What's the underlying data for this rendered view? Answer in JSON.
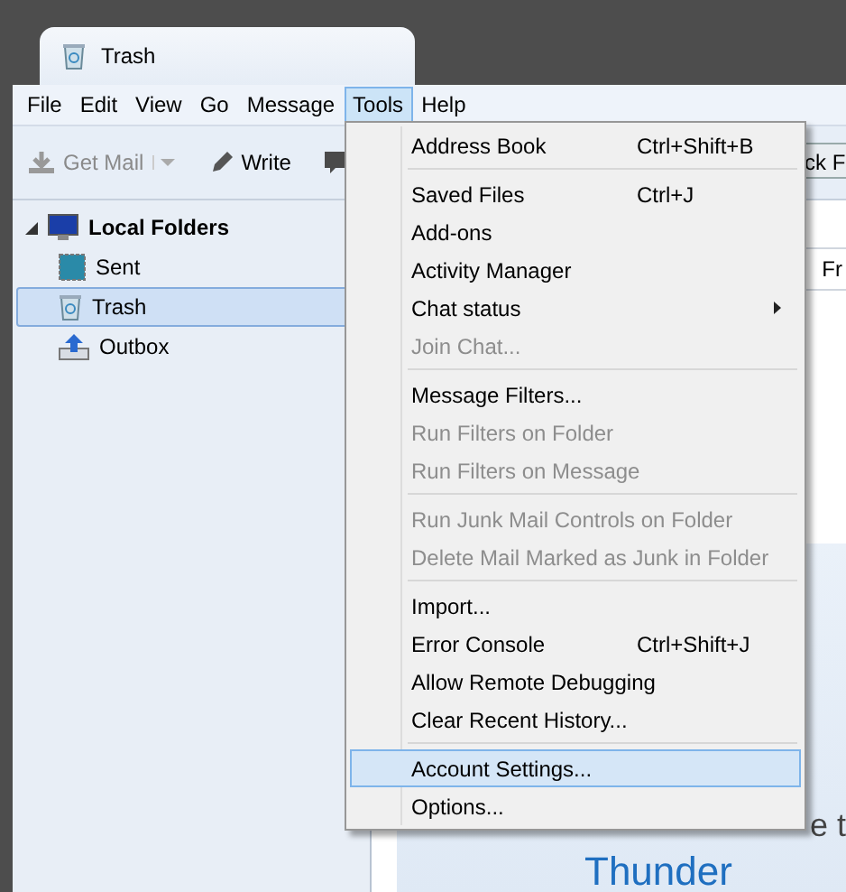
{
  "window": {
    "title": "Trash"
  },
  "menubar": [
    {
      "label": "File",
      "selected": false
    },
    {
      "label": "Edit",
      "selected": false
    },
    {
      "label": "View",
      "selected": false
    },
    {
      "label": "Go",
      "selected": false
    },
    {
      "label": "Message",
      "selected": false
    },
    {
      "label": "Tools",
      "selected": true
    },
    {
      "label": "Help",
      "selected": false
    }
  ],
  "toolbar": {
    "buttons": [
      {
        "label": "Get Mail",
        "kind": "split",
        "disabled": true
      },
      {
        "label": "Write",
        "kind": "write",
        "disabled": false
      },
      {
        "kind": "chat"
      }
    ],
    "partial_button": "ck F"
  },
  "folders": [
    {
      "label": "Local Folders",
      "kind": "computer",
      "expanded": true,
      "selected": false,
      "children": [
        {
          "label": "Sent",
          "kind": "sent",
          "selected": false
        },
        {
          "label": "Trash",
          "kind": "trash",
          "selected": true
        },
        {
          "label": "Outbox",
          "kind": "outbox",
          "selected": false
        }
      ]
    }
  ],
  "message_list": {
    "column_1": "Fr"
  },
  "welcome": {
    "line_1": "e t",
    "line_2": "Thunder"
  },
  "tools_menu": [
    {
      "kind": "item",
      "label": "Address Book",
      "shortcut": "Ctrl+Shift+B",
      "disabled": false,
      "selected": false
    },
    {
      "kind": "separator"
    },
    {
      "kind": "item",
      "label": "Saved Files",
      "shortcut": "Ctrl+J",
      "disabled": false,
      "selected": false
    },
    {
      "kind": "item",
      "label": "Add-ons",
      "disabled": false,
      "selected": false
    },
    {
      "kind": "item",
      "label": "Activity Manager",
      "disabled": false,
      "selected": false
    },
    {
      "kind": "submenu",
      "label": "Chat status",
      "disabled": false,
      "selected": false
    },
    {
      "kind": "item",
      "label": "Join Chat...",
      "disabled": true,
      "selected": false
    },
    {
      "kind": "separator"
    },
    {
      "kind": "item",
      "label": "Message Filters...",
      "disabled": false,
      "selected": false
    },
    {
      "kind": "item",
      "label": "Run Filters on Folder",
      "disabled": true,
      "selected": false
    },
    {
      "kind": "item",
      "label": "Run Filters on Message",
      "disabled": true,
      "selected": false
    },
    {
      "kind": "separator"
    },
    {
      "kind": "item",
      "label": "Run Junk Mail Controls on Folder",
      "disabled": true,
      "selected": false
    },
    {
      "kind": "item",
      "label": "Delete Mail Marked as Junk in Folder",
      "disabled": true,
      "selected": false
    },
    {
      "kind": "separator"
    },
    {
      "kind": "item",
      "label": "Import...",
      "disabled": false,
      "selected": false
    },
    {
      "kind": "item",
      "label": "Error Console",
      "shortcut": "Ctrl+Shift+J",
      "disabled": false,
      "selected": false
    },
    {
      "kind": "item",
      "label": "Allow Remote Debugging",
      "disabled": false,
      "selected": false
    },
    {
      "kind": "item",
      "label": "Clear Recent History...",
      "disabled": false,
      "selected": false
    },
    {
      "kind": "separator"
    },
    {
      "kind": "item",
      "label": "Account Settings...",
      "disabled": false,
      "selected": true
    },
    {
      "kind": "item",
      "label": "Options...",
      "disabled": false,
      "selected": false
    }
  ]
}
